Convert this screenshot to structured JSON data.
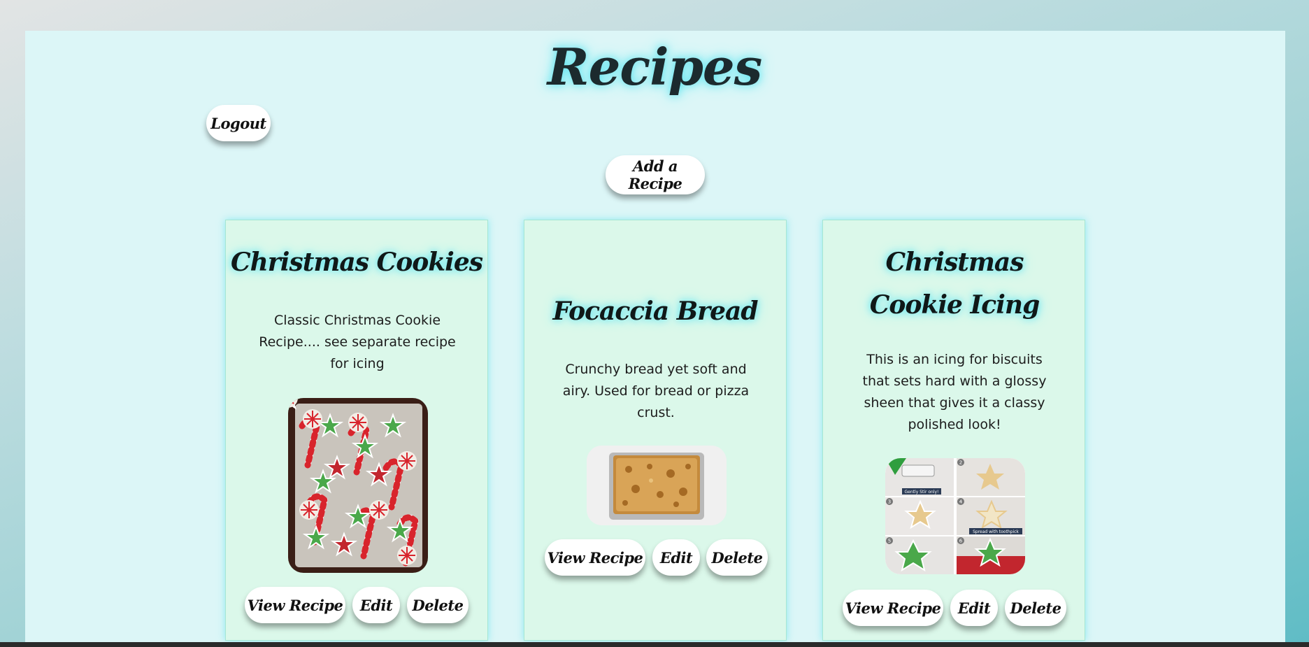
{
  "page": {
    "title": "Recipes",
    "logout_label": "Logout",
    "add_recipe_label": "Add a Recipe"
  },
  "recipes": [
    {
      "title": "Christmas Cookies",
      "description": "Classic Christmas Cookie Recipe.... see separate recipe for icing",
      "view_label": "View Recipe",
      "edit_label": "Edit",
      "delete_label": "Delete"
    },
    {
      "title": "Focaccia Bread",
      "description": "Crunchy bread yet soft and airy. Used for bread or pizza crust.",
      "view_label": "View Recipe",
      "edit_label": "Edit",
      "delete_label": "Delete"
    },
    {
      "title": "Christmas Cookie Icing",
      "description": "This is an icing for biscuits that sets hard with a glossy sheen that gives it a classy polished look!",
      "view_label": "View Recipe",
      "edit_label": "Edit",
      "delete_label": "Delete",
      "image_captions": [
        "2",
        "3",
        "4",
        "5",
        "6",
        "Gently Stir only!",
        "Spread with toothpick"
      ]
    }
  ],
  "colors": {
    "panel_bg": "#dcf6f7",
    "card_bg": "#dbf8ea",
    "glow": "#5fe3ee",
    "button_bg": "#ffffff",
    "text_dark": "#1c2a2e"
  }
}
